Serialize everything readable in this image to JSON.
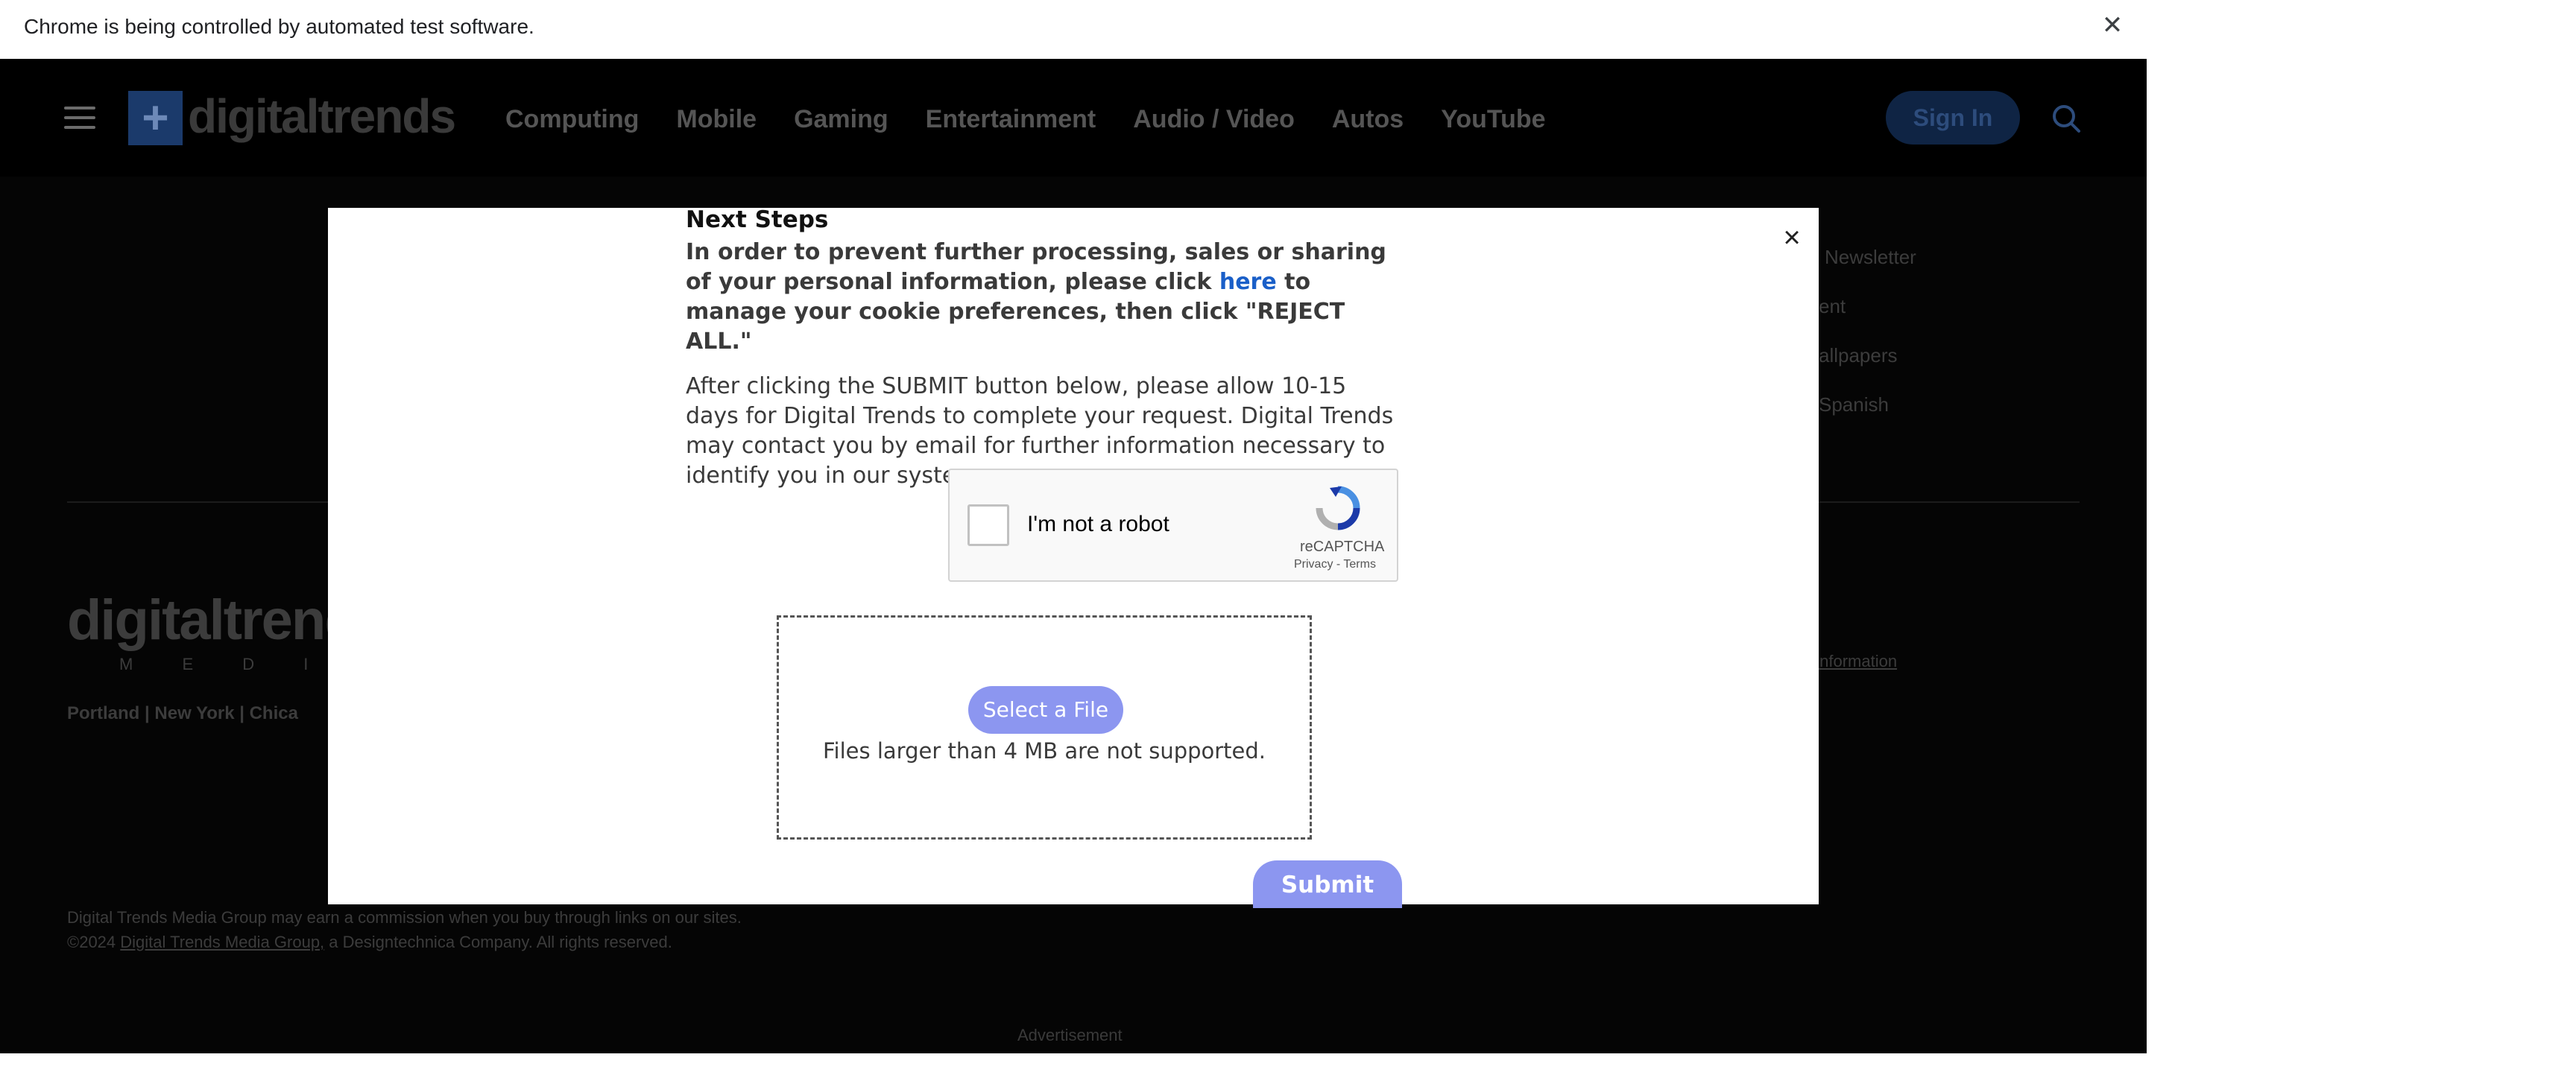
{
  "infobar": {
    "message": "Chrome is being controlled by automated test software.",
    "close_glyph": "✕"
  },
  "nav": {
    "logo_mark": "+",
    "logo_text": "digitaltrends",
    "links": [
      "Computing",
      "Mobile",
      "Gaming",
      "Entertainment",
      "Audio / Video",
      "Autos",
      "YouTube"
    ],
    "sign_in": "Sign In",
    "icons": [
      "hamburger-menu-icon",
      "search-icon"
    ]
  },
  "footer": {
    "right_links": [
      "Newsletter",
      "ent",
      "allpapers",
      "Spanish"
    ],
    "brand": "digitaltrend",
    "brand_sub": "M E D I A G R O U",
    "cities": "Portland  |  New York  |  Chica",
    "personal_info": "Information",
    "legal_line1": "Digital Trends Media Group may earn a commission when you buy through links on our sites.",
    "legal_line2_prefix": "©2024 ",
    "legal_line2_link": "Digital Trends Media Group,",
    "legal_line2_suffix": " a Designtechnica Company. All rights reserved.",
    "advertisement": "Advertisement"
  },
  "modal": {
    "close_glyph": "×",
    "heading": "Next Steps",
    "instructions_before": "In order to prevent further processing, sales or sharing of your personal information, please click ",
    "instructions_link": "here",
    "instructions_after": " to manage your cookie preferences, then click \"REJECT ALL.\"",
    "after_text": "After clicking the SUBMIT button below, please allow 10-15 days for Digital Trends to complete your request. Digital Trends may contact you by email for further information necessary to identify you in our systems.",
    "recaptcha": {
      "label": "I'm not a robot",
      "brand": "reCAPTCHA",
      "terms": "Privacy - Terms"
    },
    "upload": {
      "button": "Select a File",
      "note": "Files larger than 4 MB are not supported."
    },
    "submit": "Submit"
  },
  "colors": {
    "accent_button": "#8c96f0",
    "link_blue": "#1a5fc8",
    "nav_background": "#000000",
    "sign_in_background": "#0f2444"
  }
}
